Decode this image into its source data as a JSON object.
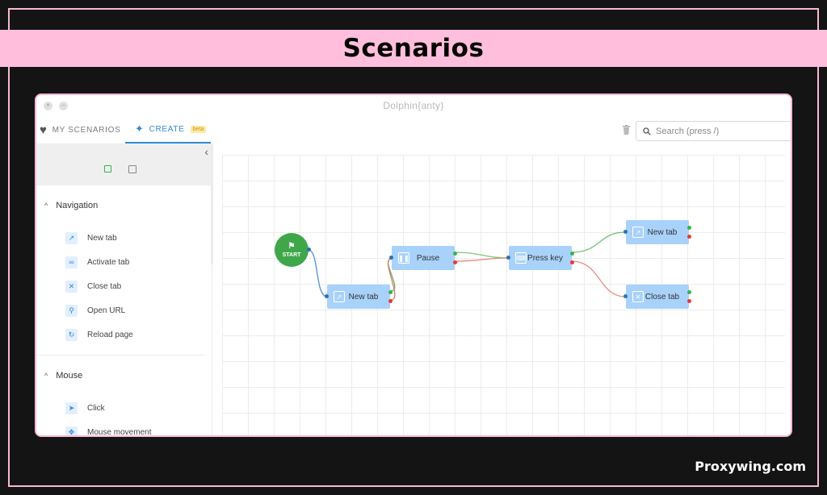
{
  "banner": {
    "title": "Scenarios"
  },
  "watermark": "Proxywing.com",
  "window": {
    "title": "Dolphin{anty}"
  },
  "tabs": {
    "my_scenarios": "MY SCENARIOS",
    "create": "CREATE",
    "beta": "beta"
  },
  "search": {
    "placeholder": "Search (press /)"
  },
  "sidebar": {
    "sections": [
      {
        "title": "Navigation",
        "items": [
          "New tab",
          "Activate tab",
          "Close tab",
          "Open URL",
          "Reload page"
        ]
      },
      {
        "title": "Mouse",
        "items": [
          "Click",
          "Mouse movement"
        ]
      }
    ]
  },
  "flow": {
    "start": "START",
    "nodes": {
      "new_tab_1": "New tab",
      "pause": "Pause",
      "press_key": "Press key",
      "new_tab_2": "New tab",
      "close_tab": "Close tab"
    }
  },
  "colors": {
    "accent": "#2f8bd8",
    "node": "#a9d2fb",
    "start": "#3fa74a",
    "success": "#37b34a",
    "error": "#e53935",
    "banner": "#ffbfdc"
  }
}
